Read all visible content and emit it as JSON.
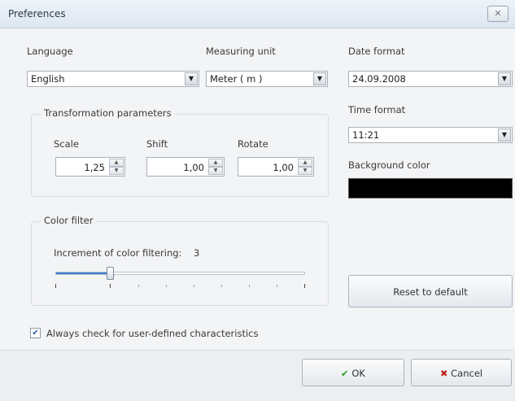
{
  "window": {
    "title": "Preferences",
    "close_glyph": "✕"
  },
  "language": {
    "label": "Language",
    "value": "English"
  },
  "measuring_unit": {
    "label": "Measuring unit",
    "value": "Meter ( m )"
  },
  "date_format": {
    "label": "Date format",
    "value": "24.09.2008"
  },
  "time_format": {
    "label": "Time format",
    "value": "11:21"
  },
  "background_color": {
    "label": "Background color",
    "value": "#000000"
  },
  "transformation": {
    "title": "Transformation parameters",
    "scale": {
      "label": "Scale",
      "value": "1,25"
    },
    "shift": {
      "label": "Shift",
      "value": "1,00"
    },
    "rotate": {
      "label": "Rotate",
      "value": "1,00"
    }
  },
  "color_filter": {
    "title": "Color filter",
    "increment_label": "Increment of color filtering:",
    "increment_value": "3",
    "slider_fraction": 0.22
  },
  "reset_label": "Reset to default",
  "always_check": {
    "label": "Always check for user-defined characteristics",
    "checked": true
  },
  "buttons": {
    "ok": "OK",
    "cancel": "Cancel"
  },
  "icons": {
    "dropdown": "chevron-down-icon",
    "ok": "check-icon",
    "cancel": "x-icon",
    "close": "close-icon"
  },
  "colors": {
    "ok_check": "#3a9a2a",
    "cancel_x": "#c0281e",
    "slider_fill": "#3b7ed0"
  }
}
